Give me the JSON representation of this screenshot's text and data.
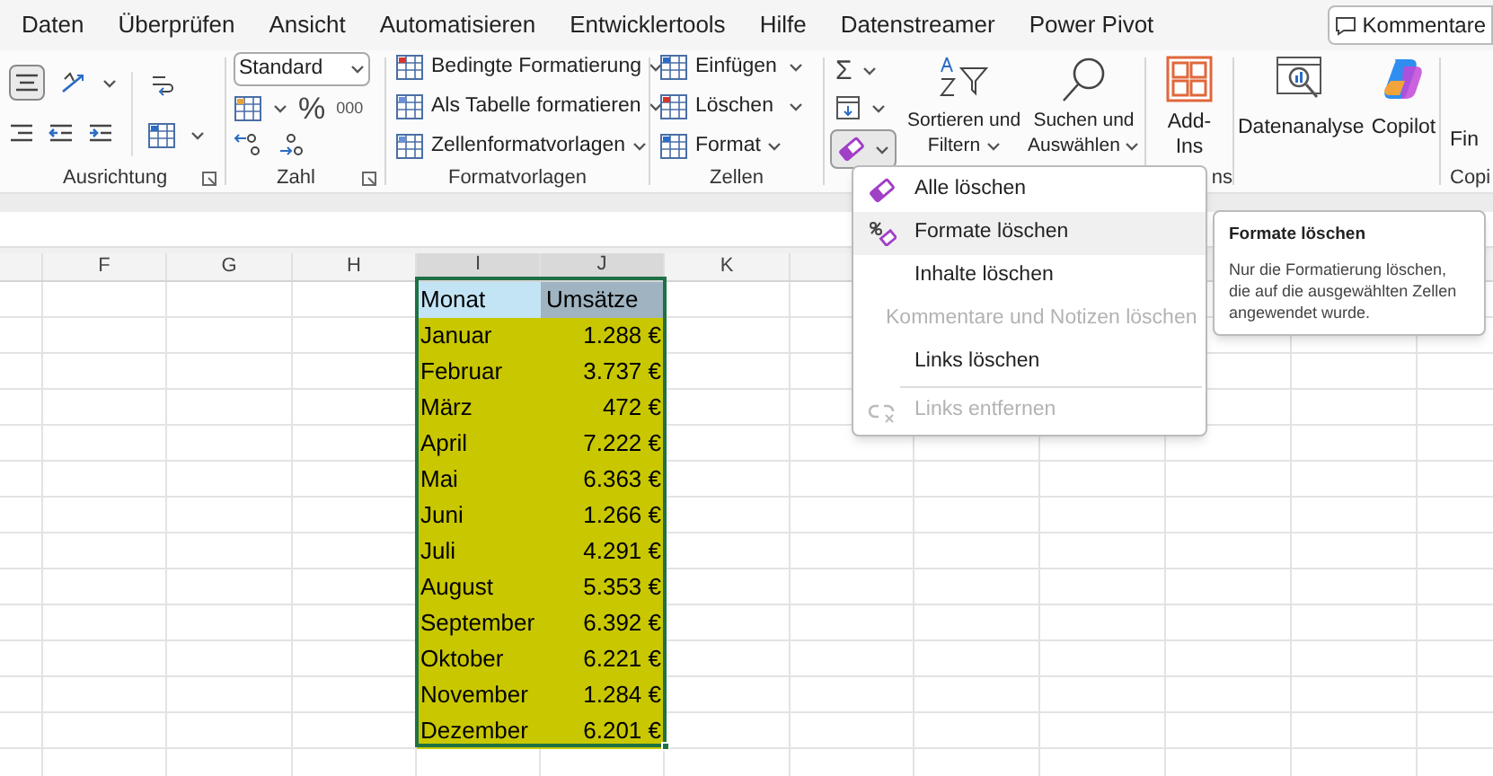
{
  "tabs": [
    {
      "label": "Daten",
      "selected": false
    },
    {
      "label": "Überprüfen",
      "selected": false
    },
    {
      "label": "Ansicht",
      "selected": false
    },
    {
      "label": "Automatisieren",
      "selected": false
    },
    {
      "label": "Entwicklertools",
      "selected": false
    },
    {
      "label": "Hilfe",
      "selected": false
    },
    {
      "label": "Datenstreamer",
      "selected": false
    },
    {
      "label": "Power Pivot",
      "selected": false
    }
  ],
  "comments_button": "Kommentare",
  "ribbon": {
    "alignment_label": "Ausrichtung",
    "number_format": "Standard",
    "percent": "%",
    "thousands": "000",
    "number_label": "Zahl",
    "styles": [
      "Bedingte Formatierung",
      "Als Tabelle formatieren",
      "Zellenformatvorlagen"
    ],
    "styles_label": "Formatvorlagen",
    "cells": [
      "Einfügen",
      "Löschen",
      "Format"
    ],
    "cells_label": "Zellen",
    "autosum": "Σ",
    "clear_button_pressed": true,
    "sort": [
      "Sortieren und",
      "Filtern"
    ],
    "find": [
      "Suchen und",
      "Auswählen"
    ],
    "addins": [
      "Add-",
      "Ins"
    ],
    "addins_label_fragment": "ns",
    "analysis": "Datenanalyse",
    "copilot": "Copilot",
    "cut_button": "Fin",
    "cut_label": "Copi"
  },
  "column_headers": [
    {
      "label": "F",
      "selected": false
    },
    {
      "label": "G",
      "selected": false
    },
    {
      "label": "H",
      "selected": false
    },
    {
      "label": "I",
      "selected": true
    },
    {
      "label": "J",
      "selected": true
    },
    {
      "label": "K",
      "selected": false
    }
  ],
  "table": [
    {
      "kind": "header",
      "month": "Monat",
      "sales": "Umsätze"
    },
    {
      "kind": "data",
      "month": "Januar",
      "sales": "1.288 €"
    },
    {
      "kind": "data",
      "month": "Februar",
      "sales": "3.737 €"
    },
    {
      "kind": "data",
      "month": "März",
      "sales": "472 €"
    },
    {
      "kind": "data",
      "month": "April",
      "sales": "7.222 €"
    },
    {
      "kind": "data",
      "month": "Mai",
      "sales": "6.363 €"
    },
    {
      "kind": "data",
      "month": "Juni",
      "sales": "1.266 €"
    },
    {
      "kind": "data",
      "month": "Juli",
      "sales": "4.291 €"
    },
    {
      "kind": "data",
      "month": "August",
      "sales": "5.353 €"
    },
    {
      "kind": "data",
      "month": "September",
      "sales": "6.392 €"
    },
    {
      "kind": "data",
      "month": "Oktober",
      "sales": "6.221 €"
    },
    {
      "kind": "data",
      "month": "November",
      "sales": "1.284 €"
    },
    {
      "kind": "data",
      "month": "Dezember",
      "sales": "6.201 €"
    }
  ],
  "menu": [
    {
      "label": "Alle löschen",
      "kind": "eraser",
      "disabled": false,
      "selected": false,
      "separator_before": false
    },
    {
      "label": "Formate löschen",
      "kind": "format-eraser",
      "disabled": false,
      "selected": true,
      "separator_before": false
    },
    {
      "label": "Inhalte löschen",
      "kind": "plain",
      "disabled": false,
      "selected": false,
      "separator_before": false
    },
    {
      "label": "Kommentare und Notizen löschen",
      "kind": "plain",
      "disabled": true,
      "selected": false,
      "separator_before": false
    },
    {
      "label": "Links löschen",
      "kind": "plain",
      "disabled": false,
      "selected": false,
      "separator_before": false
    },
    {
      "label": "Links entfernen",
      "kind": "unlink",
      "disabled": true,
      "selected": false,
      "separator_before": true
    }
  ],
  "tooltip": {
    "title": "Formate löschen",
    "text": "Nur die Formatierung löschen, die auf die ausgewählten Zellen angewendet wurde."
  }
}
